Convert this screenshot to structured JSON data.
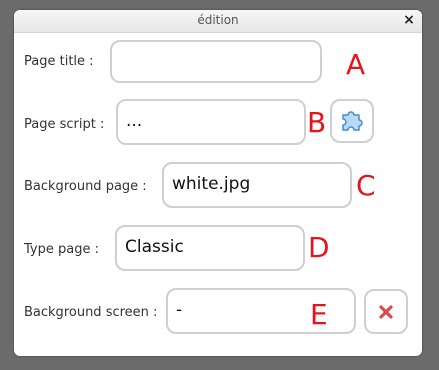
{
  "window": {
    "title": "édition",
    "close_glyph": "×"
  },
  "fields": [
    {
      "label": "Page title :",
      "value": "",
      "marker": "A"
    },
    {
      "label": "Page script :",
      "value": "...",
      "marker": "B"
    },
    {
      "label": "Background page :",
      "value": "white.jpg",
      "marker": "C"
    },
    {
      "label": "Type page :",
      "value": "Classic",
      "marker": "D"
    },
    {
      "label": "Background screen :",
      "value": "-",
      "marker": "E"
    }
  ],
  "icons": {
    "script": "puzzle-icon",
    "clear": "clear-icon"
  },
  "colors": {
    "marker": "#e8141d",
    "clear_icon": "#e04848",
    "puzzle_icon": "#3b8fd6"
  }
}
